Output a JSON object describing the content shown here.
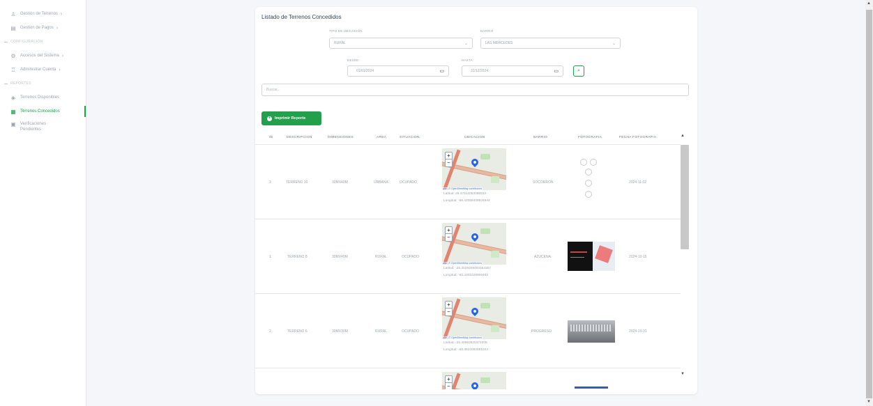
{
  "sidebar": {
    "items": [
      {
        "type": "item",
        "icon": "building-icon",
        "label": "Gestión de Terrenos",
        "chevron": true
      },
      {
        "type": "item",
        "icon": "card-icon",
        "label": "Gestion de Pagos",
        "chevron": true
      },
      {
        "type": "section",
        "label": "CONFIGURACIÓN"
      },
      {
        "type": "item",
        "icon": "gear-icon",
        "label": "Accesos del Sistema",
        "chevron": true
      },
      {
        "type": "item",
        "icon": "users-icon",
        "label": "Administrar Cuenta",
        "chevron": true
      },
      {
        "type": "section",
        "label": "REPORTES"
      },
      {
        "type": "item",
        "icon": "location-icon",
        "label": "Terrenos Disponibles",
        "chevron": false
      },
      {
        "type": "item",
        "icon": "grid-icon",
        "label": "Terrenos Concedidos",
        "chevron": false,
        "active": true
      },
      {
        "type": "item",
        "icon": "clipboard-icon",
        "label": "Verificaciones Pendientes",
        "chevron": false
      }
    ]
  },
  "main": {
    "title": "Listado de Terrenos Concedidos",
    "filters": {
      "tipo_label": "TIPO DE UBICACIÓN",
      "tipo_value": "RURAL",
      "barrio_label": "BARRIO",
      "barrio_value": "LAS MERCEDES",
      "desde_label": "DESDE:",
      "desde_value": "01/01/2024",
      "hasta_label": "HASTA:",
      "hasta_value": "31/12/2024"
    },
    "search_placeholder": "Buscar...",
    "print_label": "Imprimir Reporte",
    "columns": [
      "ID",
      "DESCRIPCION",
      "DIMENSIONES",
      "AREA",
      "SITUACION",
      "UBICACION",
      "BARRIO",
      "FOTOGRAFIA",
      "FECHA FOTOGRAFIA"
    ],
    "rows": [
      {
        "id": "3",
        "descripcion": "TERRENO 10",
        "dimensiones": "30MX40M",
        "area": "URBANA",
        "situacion": "OCUPADO",
        "map_attr": "afle | © OpenStreetMap contributors",
        "lat": "Latitud: 25.47914053068933",
        "lng": "Longitud: -56.43358408934944",
        "barrio": "SOCORRON",
        "foto": "sketch",
        "fecha": "2024-11-02"
      },
      {
        "id": "1",
        "descripcion": "TERRENO 8",
        "dimensiones": "30MX40M",
        "area": "RURAL",
        "situacion": "OCUPADO",
        "map_attr": "afle | © OpenStreetMap contributors",
        "lat": "Latitud: -25.4029209483354307",
        "lng": "Longitud: -56.4305328906482",
        "barrio": "AZUCENA",
        "foto": "screen",
        "fecha": "2024-10-15"
      },
      {
        "id": "2",
        "descripcion": "TERRENO 6",
        "dimensiones": "30MX30M",
        "area": "RURAL",
        "situacion": "OCUPADO",
        "map_attr": "afle | © OpenStreetMap contributors",
        "lat": "Latitud: -25.40963825374005",
        "lng": "Longitud: -56.3834092881024",
        "barrio": "PROGRESO",
        "foto": "grey",
        "fecha": "2024-10-31"
      },
      {
        "id": "",
        "descripcion": "",
        "dimensiones": "",
        "area": "",
        "situacion": "",
        "map_attr": "",
        "lat": "",
        "lng": "",
        "barrio": "",
        "foto": "blue",
        "fecha": ""
      }
    ]
  },
  "colors": {
    "accent": "#22a04b",
    "active": "#16a34a"
  }
}
